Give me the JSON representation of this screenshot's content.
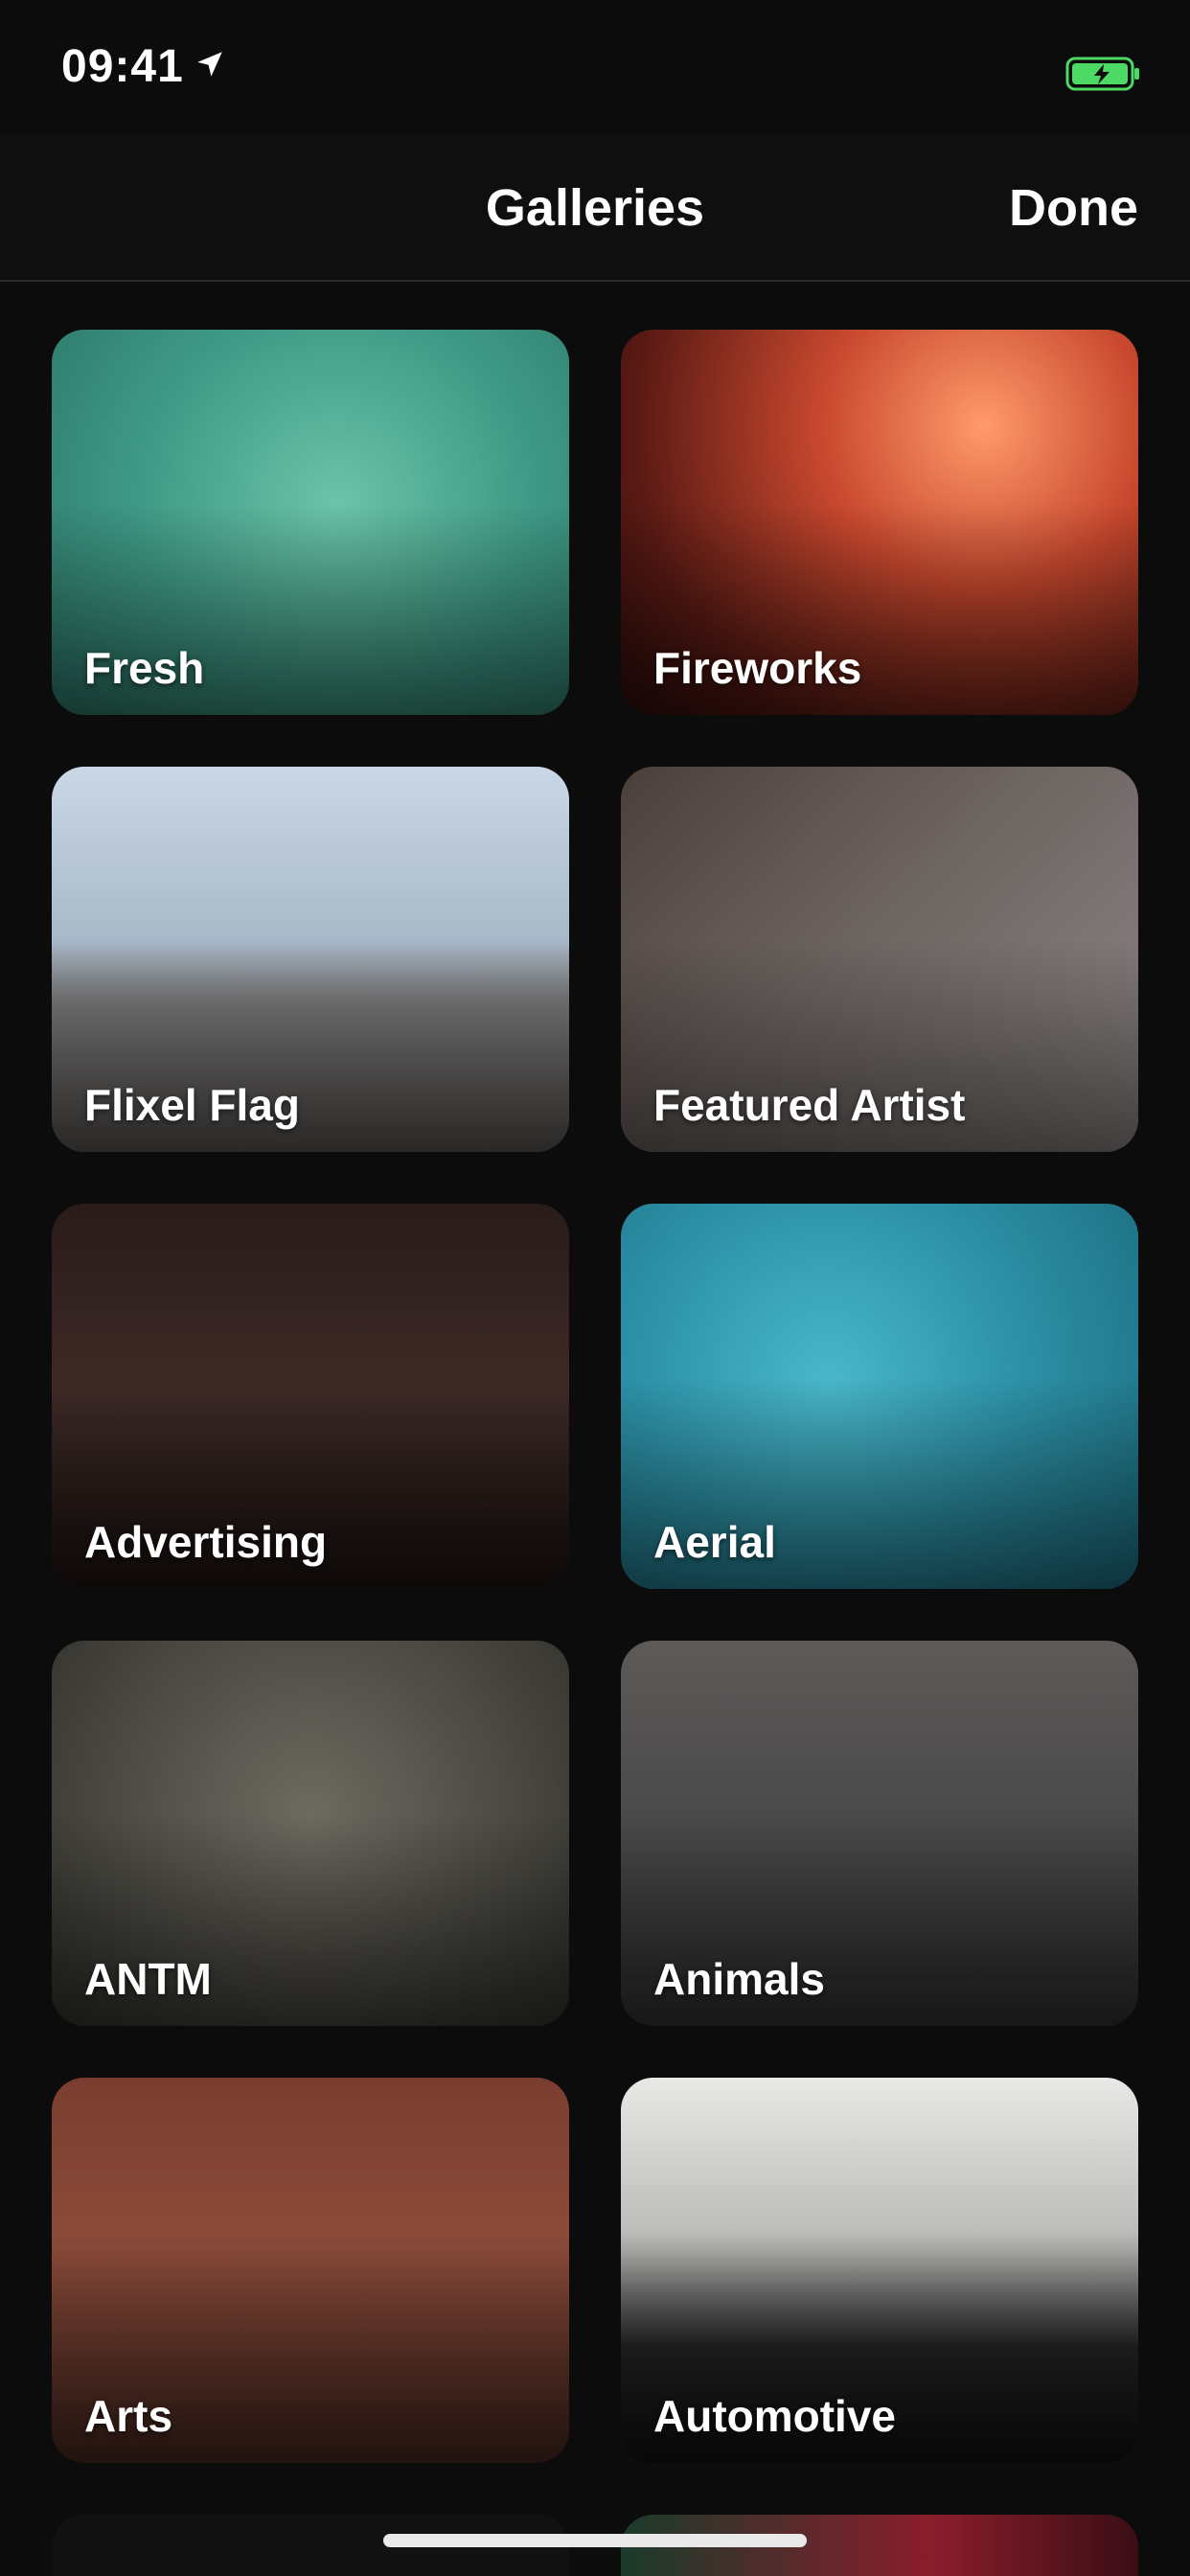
{
  "status_bar": {
    "time": "09:41",
    "location_icon": "location-arrow-icon",
    "battery_icon": "battery-charging-icon",
    "battery_color": "#4cd964"
  },
  "nav": {
    "title": "Galleries",
    "done_label": "Done"
  },
  "galleries": [
    {
      "label": "Fresh",
      "bg": "bg-fresh"
    },
    {
      "label": "Fireworks",
      "bg": "bg-fireworks"
    },
    {
      "label": "Flixel Flag",
      "bg": "bg-flag"
    },
    {
      "label": "Featured Artist",
      "bg": "bg-featured"
    },
    {
      "label": "Advertising",
      "bg": "bg-advertising"
    },
    {
      "label": "Aerial",
      "bg": "bg-aerial"
    },
    {
      "label": "ANTM",
      "bg": "bg-antm"
    },
    {
      "label": "Animals",
      "bg": "bg-animals"
    },
    {
      "label": "Arts",
      "bg": "bg-arts"
    },
    {
      "label": "Automotive",
      "bg": "bg-automotive"
    }
  ]
}
